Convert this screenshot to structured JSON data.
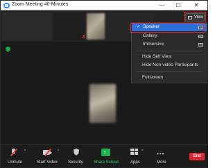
{
  "window": {
    "title": "Zoom Meeting 40-Minutes",
    "minimize_glyph": "—",
    "maximize_glyph": "☐",
    "close_glyph": "✕"
  },
  "view_button": {
    "label": "View",
    "icon": "grid-view-icon"
  },
  "menu": {
    "items": [
      {
        "label": "Speaker",
        "selected": true,
        "check": "✓",
        "icon": "speaker-layout-icon"
      },
      {
        "label": "Gallery",
        "selected": false,
        "icon": "gallery-layout-icon"
      },
      {
        "label": "Immersive",
        "selected": false,
        "icon": "immersive-layout-icon"
      },
      {
        "label": "Hide Self View"
      },
      {
        "label": "Hide Non-video Participants"
      },
      {
        "label": "Fullscreen"
      }
    ]
  },
  "toolbar": {
    "unmute": "Unmute",
    "start_video": "Start Video",
    "security": "Security",
    "share_screen": "Share Screen",
    "apps": "Apps",
    "more": "More",
    "end": "End",
    "caret": "^",
    "share_arrow": "↑",
    "more_dots": "•••"
  },
  "indicators": {
    "mute_glyph": "✗"
  },
  "colors": {
    "accent_blue": "#2f6fd8",
    "highlight_red": "#e3262f",
    "end_red": "#e0262f",
    "share_green": "#23b14d",
    "shield_green": "#25a244",
    "mute_red": "#e23b3b"
  }
}
